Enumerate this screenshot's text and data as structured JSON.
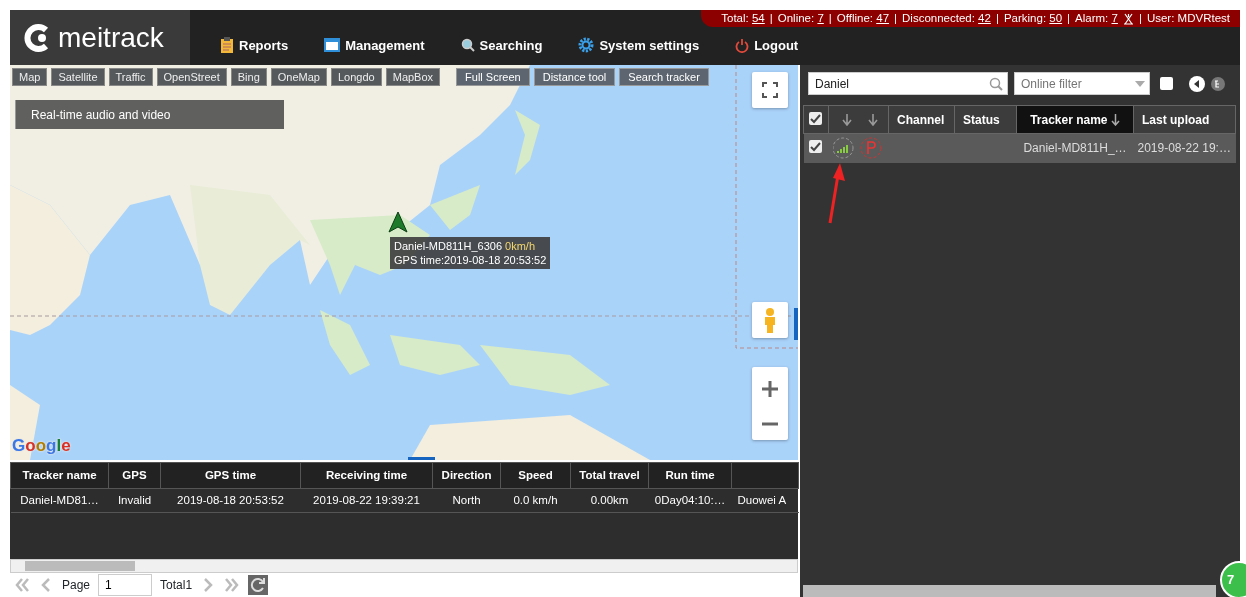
{
  "logo": {
    "text": "meitrack"
  },
  "status_bar": {
    "items": [
      {
        "label": "Total:",
        "value": "54",
        "kind": "count"
      },
      {
        "label": "Online:",
        "value": "7",
        "kind": "count"
      },
      {
        "label": "Offline:",
        "value": "47",
        "kind": "count"
      },
      {
        "label": "Disconnected:",
        "value": "42",
        "kind": "count"
      },
      {
        "label": "Parking:",
        "value": "50",
        "kind": "count"
      },
      {
        "label": "Alarm:",
        "value": "7",
        "kind": "alarm"
      }
    ],
    "separator": "|",
    "user": "User: MDVRtest"
  },
  "nav": [
    "Reports",
    "Management",
    "Searching",
    "System settings",
    "Logout"
  ],
  "map": {
    "layer_buttons": [
      "Map",
      "Satellite",
      "Traffic",
      "OpenStreet",
      "Bing",
      "OneMap",
      "Longdo",
      "MapBox"
    ],
    "tool_buttons": [
      "Full Screen",
      "Distance tool",
      "Search tracker"
    ],
    "media_panel": "Real-time audio and video",
    "marker": {
      "name": "Daniel-MD811H_6306",
      "speed": "0km/h",
      "gps_time": "GPS time:2019-08-18 20:53:52"
    },
    "attribution": "Google"
  },
  "tracker_panel": {
    "search": {
      "value": "Daniel"
    },
    "filter": {
      "placeholder": "Online filter"
    },
    "show_all_checked": false,
    "table": {
      "all_checked": true,
      "columns": [
        {
          "label": "Channel",
          "sorted": false
        },
        {
          "label": "Status",
          "sorted": false
        },
        {
          "label": "Tracker name",
          "sorted": true
        },
        {
          "label": "Last upload",
          "sorted": false
        }
      ],
      "rows": [
        {
          "checked": true,
          "selected": true,
          "tracker_name": "Daniel-MD811H_…",
          "last_upload": "2019-08-22 19:…"
        }
      ]
    }
  },
  "history_table": {
    "columns": [
      "Tracker name",
      "GPS",
      "GPS time",
      "Receiving time",
      "Direction",
      "Speed",
      "Total travel",
      "Run time"
    ],
    "rows": [
      {
        "cells": [
          "Daniel-MD81…",
          "Invalid",
          "2019-08-18 20:53:52",
          "2019-08-22 19:39:21",
          "North",
          "0.0 km/h",
          "0.00km",
          "0Day04:10:…",
          "Duowei A"
        ]
      }
    ]
  },
  "pagination": {
    "page_label": "Page",
    "page": "1",
    "total": "Total1"
  },
  "corner_badge": "7"
}
